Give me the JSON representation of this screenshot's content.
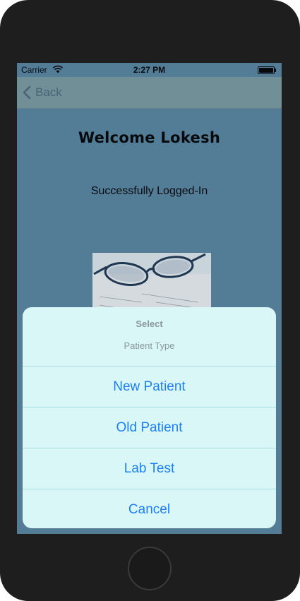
{
  "status_bar": {
    "carrier": "Carrier",
    "time": "2:27 PM"
  },
  "nav": {
    "back_label": "Back"
  },
  "main": {
    "welcome": "Welcome Lokesh",
    "status_message": "Successfully Logged-In"
  },
  "action_sheet": {
    "title": "Select",
    "message": "Patient Type",
    "actions": [
      {
        "label": "New Patient"
      },
      {
        "label": "Old Patient"
      },
      {
        "label": "Lab Test"
      }
    ],
    "cancel": "Cancel"
  },
  "colors": {
    "accent": "#1d7ff5",
    "sheet_background": "#daf7f8",
    "screen_background": "#5b87a3"
  }
}
